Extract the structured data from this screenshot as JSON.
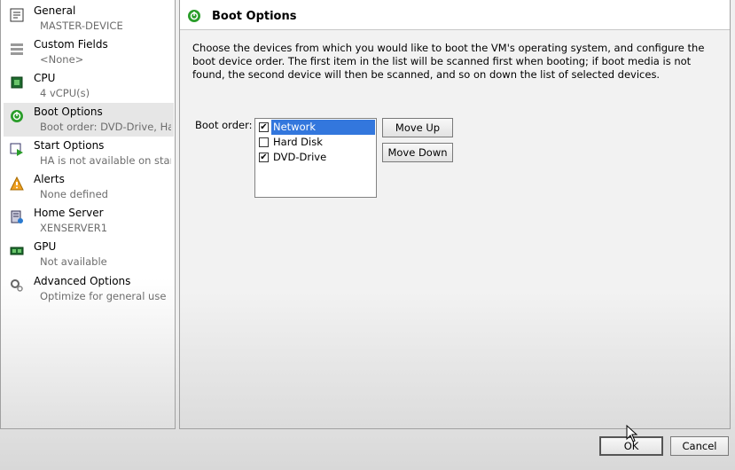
{
  "sidebar": {
    "items": [
      {
        "title": "General",
        "sub": "MASTER-DEVICE",
        "icon": "general-icon"
      },
      {
        "title": "Custom Fields",
        "sub": "<None>",
        "icon": "custom-fields-icon"
      },
      {
        "title": "CPU",
        "sub": "4 vCPU(s)",
        "icon": "cpu-icon"
      },
      {
        "title": "Boot Options",
        "sub": "Boot order: DVD-Drive, Har...",
        "icon": "boot-options-icon"
      },
      {
        "title": "Start Options",
        "sub": "HA is not available on stan...",
        "icon": "start-options-icon"
      },
      {
        "title": "Alerts",
        "sub": "None defined",
        "icon": "alert-icon"
      },
      {
        "title": "Home Server",
        "sub": "XENSERVER1",
        "icon": "home-server-icon"
      },
      {
        "title": "GPU",
        "sub": "Not available",
        "icon": "gpu-icon"
      },
      {
        "title": "Advanced Options",
        "sub": "Optimize for general use",
        "icon": "advanced-options-icon"
      }
    ]
  },
  "main": {
    "title": "Boot Options",
    "description": "Choose the devices from which you would like to boot the VM's operating system, and configure the boot device order. The first item in the list will be scanned first when booting; if boot media is not found, the second device will then be scanned, and so on down the list of selected devices.",
    "boot_order_label": "Boot order:",
    "boot_items": [
      {
        "label": "Network",
        "checked": true,
        "selected": true
      },
      {
        "label": "Hard Disk",
        "checked": false,
        "selected": false
      },
      {
        "label": "DVD-Drive",
        "checked": true,
        "selected": false
      }
    ],
    "move_up_label": "Move Up",
    "move_down_label": "Move Down"
  },
  "footer": {
    "ok_label": "OK",
    "cancel_label": "Cancel"
  },
  "colors": {
    "selection": "#3377dd",
    "accent_green": "#2a9d2a"
  }
}
